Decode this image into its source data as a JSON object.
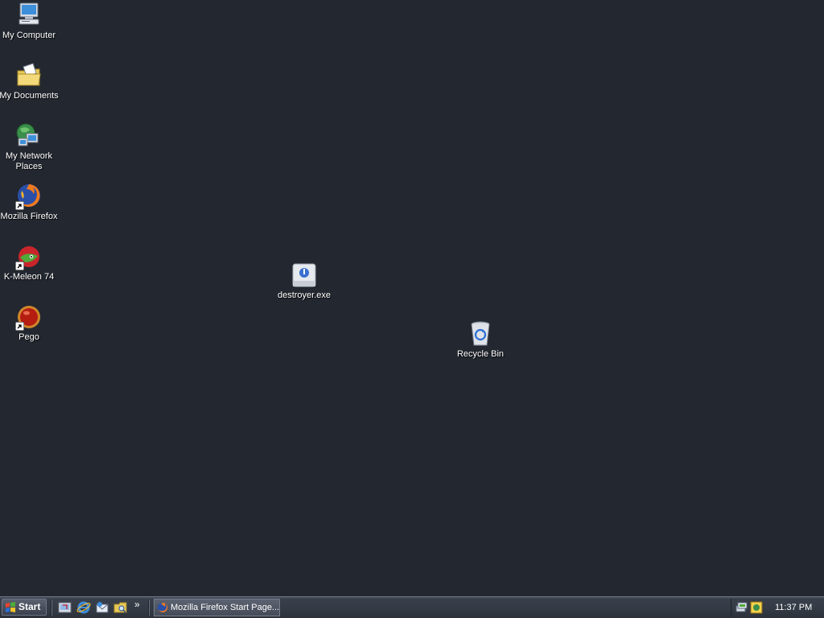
{
  "desktop": {
    "background_color": "#232830",
    "icons": [
      {
        "label": "My Computer",
        "icon": "my-computer-icon"
      },
      {
        "label": "My Documents",
        "icon": "my-documents-folder-icon"
      },
      {
        "label": "My Network Places",
        "icon": "network-places-icon"
      },
      {
        "label": "Mozilla Firefox",
        "icon": "firefox-icon",
        "shortcut": true
      },
      {
        "label": "K-Meleon 74",
        "icon": "k-meleon-icon",
        "shortcut": true
      },
      {
        "label": "Pego",
        "icon": "pego-icon",
        "shortcut": true
      },
      {
        "label": "destroyer.exe",
        "icon": "executable-icon"
      },
      {
        "label": "Recycle Bin",
        "icon": "recycle-bin-icon"
      }
    ]
  },
  "taskbar": {
    "start_label": "Start",
    "quick_launch": [
      {
        "icon": "show-desktop-icon"
      },
      {
        "icon": "internet-explorer-icon"
      },
      {
        "icon": "outlook-express-icon"
      },
      {
        "icon": "windows-explorer-icon"
      }
    ],
    "quick_launch_more": "»",
    "tasks": [
      {
        "label": "Mozilla Firefox Start Page...",
        "icon": "firefox-icon"
      }
    ],
    "tray": {
      "icons": [
        {
          "icon": "network-tray-icon"
        },
        {
          "icon": "security-tray-icon"
        }
      ],
      "clock": "11:37 PM"
    }
  }
}
